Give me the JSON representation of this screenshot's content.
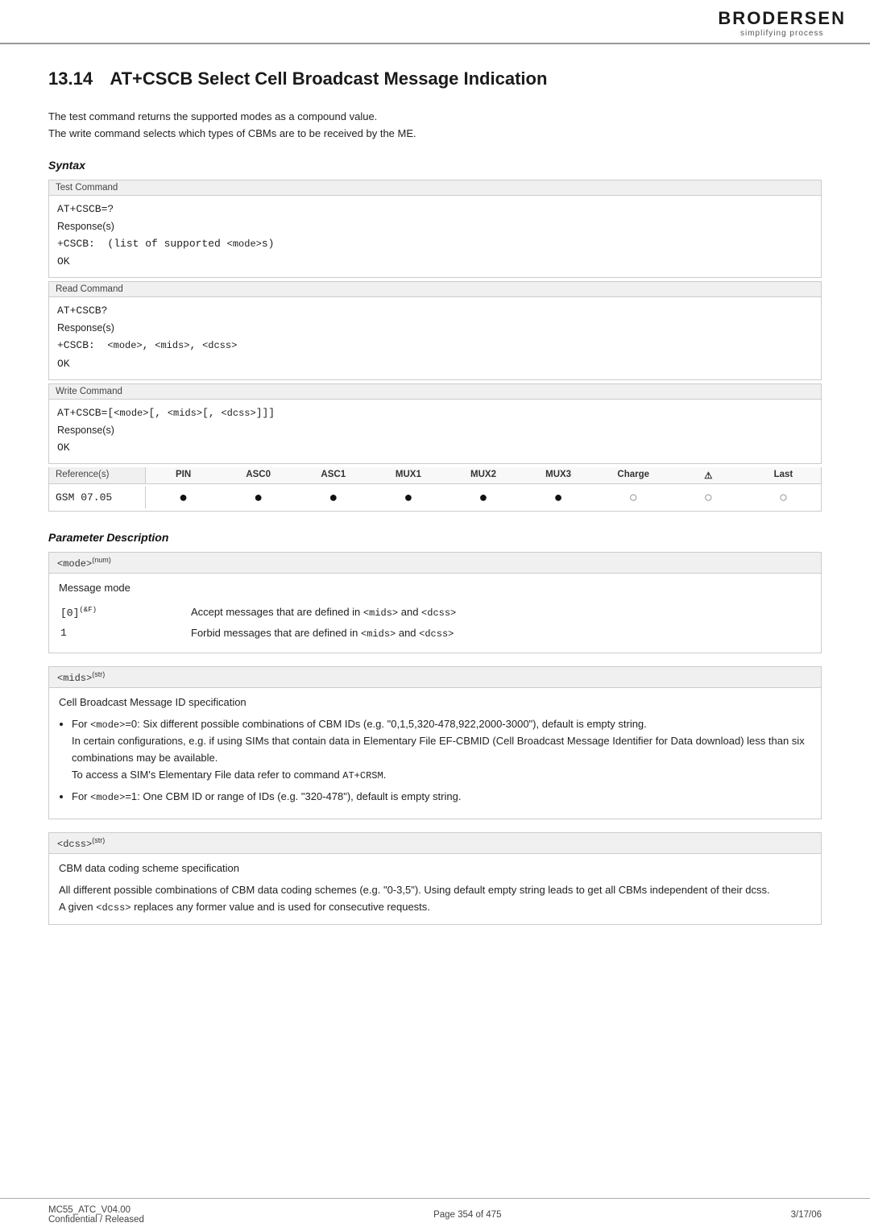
{
  "header": {
    "logo_text": "BRODERSEN",
    "logo_subtitle": "simplifying process"
  },
  "section": {
    "number": "13.14",
    "title": "AT+CSCB   Select Cell Broadcast Message Indication",
    "intro_lines": [
      "The test command returns the supported modes as a compound value.",
      "The write command selects which types of CBMs are to be received by the ME."
    ]
  },
  "syntax_heading": "Syntax",
  "commands": [
    {
      "label": "Test Command",
      "cmd": "AT+CSCB=?",
      "response_label": "Response(s)",
      "response": "+CSCB:  (list of supported <mode>s)",
      "ok": "OK"
    },
    {
      "label": "Read Command",
      "cmd": "AT+CSCB?",
      "response_label": "Response(s)",
      "response": "+CSCB:  <mode>, <mids>, <dcss>",
      "ok": "OK"
    },
    {
      "label": "Write Command",
      "cmd": "AT+CSCB=[<mode>[, <mids>[, <dcss>]]]",
      "response_label": "Response(s)",
      "ok": "OK"
    }
  ],
  "reference": {
    "label": "Reference(s)",
    "columns": [
      "PIN",
      "ASC0",
      "ASC1",
      "MUX1",
      "MUX2",
      "MUX3",
      "Charge",
      "&#x26A0;",
      "Last"
    ],
    "row_label": "GSM 07.05",
    "dots": [
      "filled",
      "filled",
      "filled",
      "filled",
      "filled",
      "filled",
      "empty",
      "empty",
      "empty"
    ]
  },
  "param_heading": "Parameter Description",
  "parameters": [
    {
      "id": "mode",
      "type": "num",
      "header": "<mode>(num)",
      "name": "Message mode",
      "values": [
        {
          "val": "[0](&#x26AF;)",
          "desc": "Accept messages that are defined in <mids> and <dcss>"
        },
        {
          "val": "1",
          "desc": "Forbid messages that are defined in <mids> and <dcss>"
        }
      ]
    },
    {
      "id": "mids",
      "type": "str",
      "header": "<mids>(str)",
      "name": "Cell Broadcast Message ID specification",
      "bullets": [
        "For <mode>=0: Six different possible combinations of CBM IDs (e.g. \"0,1,5,320-478,922,2000-3000\"), default is empty string.\nIn certain configurations, e.g. if using SIMs that contain data in Elementary File EF-CBMID (Cell Broadcast Message Identifier for Data download) less than six combinations may be available.\nTo access a SIM's Elementary File data refer to command AT+CRSM.",
        "For <mode>=1: One CBM ID or range of IDs (e.g. \"320-478\"), default is empty string."
      ]
    },
    {
      "id": "dcss",
      "type": "str",
      "header": "<dcss>(str)",
      "name": "CBM data coding scheme specification",
      "body": "All different possible combinations of CBM data coding schemes (e.g. \"0-3,5\"). Using default empty string leads to get all CBMs independent of their dcss.\nA given <dcss> replaces any former value and is used for consecutive requests."
    }
  ],
  "footer": {
    "left": "MC55_ATC_V04.00\nConfidential / Released",
    "center": "Page 354 of 475",
    "right": "3/17/06"
  }
}
